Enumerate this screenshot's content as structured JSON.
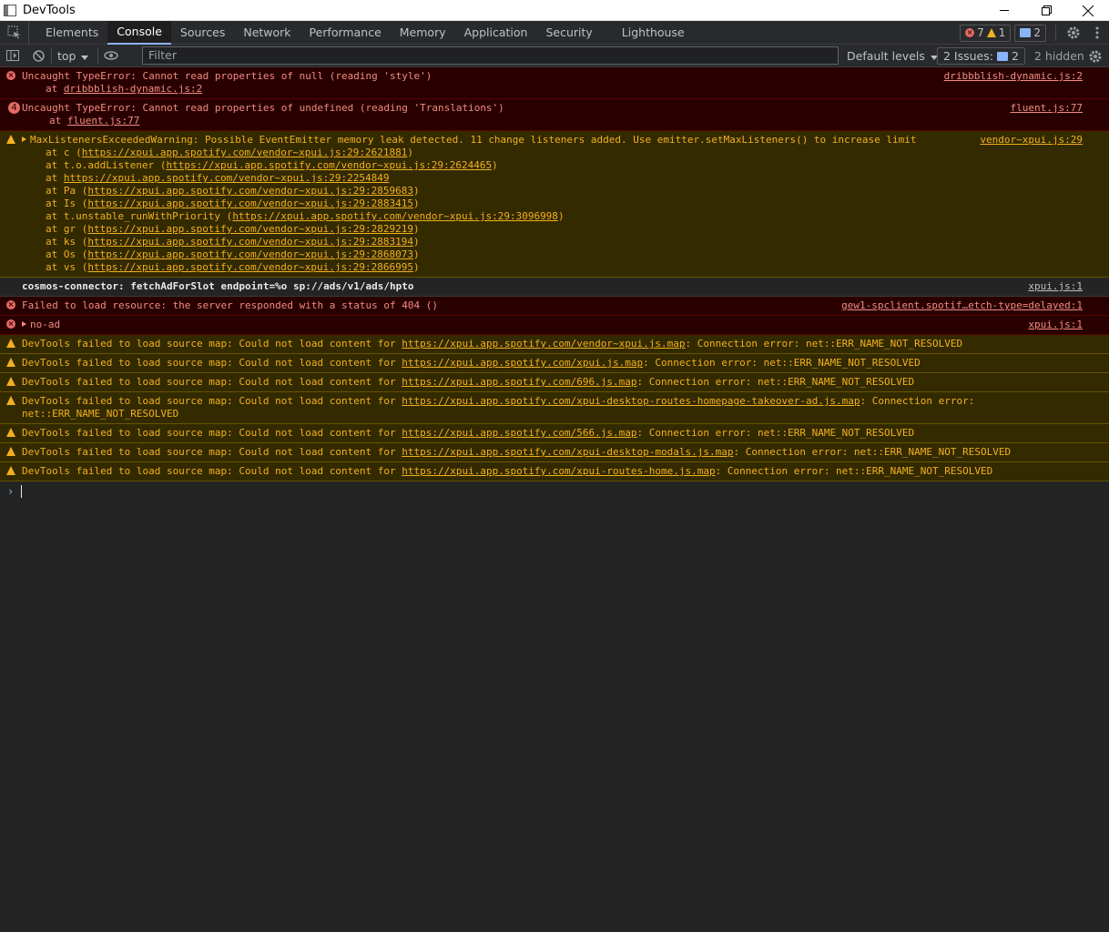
{
  "window": {
    "title": "DevTools"
  },
  "tabs": [
    "Elements",
    "Console",
    "Sources",
    "Network",
    "Performance",
    "Memory",
    "Application",
    "Security",
    "Lighthouse"
  ],
  "active_tab": "Console",
  "counts": {
    "errors": "7",
    "warnings": "1",
    "messages": "2"
  },
  "toolbar": {
    "context": "top",
    "filter_placeholder": "Filter",
    "levels": "Default levels",
    "issues_label": "2 Issues:",
    "issues_count": "2",
    "hidden": "2 hidden"
  },
  "colors": {
    "error_bg": "#290000",
    "warn_bg": "#332a00",
    "error_text": "#f28b82",
    "warn_text": "#f2b021",
    "accent": "#8ab4f8"
  },
  "messages": [
    {
      "level": "error",
      "icon": "error-icon",
      "text": "Uncaught TypeError: Cannot read properties of null (reading 'style')",
      "source": "dribbblish-dynamic.js:2",
      "stack_prefix": "at ",
      "stack_link": "dribbblish-dynamic.js:2"
    },
    {
      "level": "error",
      "icon": "error-count",
      "count": "4",
      "text": "Uncaught TypeError: Cannot read properties of undefined (reading 'Translations')",
      "source": "fluent.js:77",
      "stack_prefix": "at ",
      "stack_link": "fluent.js:77"
    },
    {
      "level": "warning",
      "text": "MaxListenersExceededWarning: Possible EventEmitter memory leak detected. 11 change listeners added. Use emitter.setMaxListeners() to increase limit",
      "source": "vendor~xpui.js:29",
      "stack": [
        {
          "fn": "at c (",
          "url": "https://xpui.app.spotify.com/vendor~xpui.js:29:2621881",
          "end": ")"
        },
        {
          "fn": "at t.o.addListener (",
          "url": "https://xpui.app.spotify.com/vendor~xpui.js:29:2624465",
          "end": ")"
        },
        {
          "fn": "at ",
          "url": "https://xpui.app.spotify.com/vendor~xpui.js:29:2254849",
          "end": ""
        },
        {
          "fn": "at Pa (",
          "url": "https://xpui.app.spotify.com/vendor~xpui.js:29:2859683",
          "end": ")"
        },
        {
          "fn": "at Is (",
          "url": "https://xpui.app.spotify.com/vendor~xpui.js:29:2883415",
          "end": ")"
        },
        {
          "fn": "at t.unstable_runWithPriority (",
          "url": "https://xpui.app.spotify.com/vendor~xpui.js:29:3096998",
          "end": ")"
        },
        {
          "fn": "at gr (",
          "url": "https://xpui.app.spotify.com/vendor~xpui.js:29:2829219",
          "end": ")"
        },
        {
          "fn": "at ks (",
          "url": "https://xpui.app.spotify.com/vendor~xpui.js:29:2883194",
          "end": ")"
        },
        {
          "fn": "at Os (",
          "url": "https://xpui.app.spotify.com/vendor~xpui.js:29:2868073",
          "end": ")"
        },
        {
          "fn": "at vs (",
          "url": "https://xpui.app.spotify.com/vendor~xpui.js:29:2866995",
          "end": ")"
        }
      ]
    },
    {
      "level": "info",
      "text": "cosmos-connector:  fetchAdForSlot endpoint=%o sp://ads/v1/ads/hpto",
      "source": "xpui.js:1"
    },
    {
      "level": "error",
      "icon": "error-icon",
      "text": "Failed to load resource: the server responded with a status of 404 ()",
      "source": "gew1-spclient.spotif…etch-type=delayed:1"
    },
    {
      "level": "error",
      "icon": "error-icon",
      "expand": true,
      "text": "no-ad",
      "source": "xpui.js:1"
    },
    {
      "level": "warning",
      "pre": "DevTools failed to load source map: Could not load content for ",
      "url": "https://xpui.app.spotify.com/vendor~xpui.js.map",
      "post": ": Connection error: net::ERR_NAME_NOT_RESOLVED"
    },
    {
      "level": "warning",
      "pre": "DevTools failed to load source map: Could not load content for ",
      "url": "https://xpui.app.spotify.com/xpui.js.map",
      "post": ": Connection error: net::ERR_NAME_NOT_RESOLVED"
    },
    {
      "level": "warning",
      "pre": "DevTools failed to load source map: Could not load content for ",
      "url": "https://xpui.app.spotify.com/696.js.map",
      "post": ": Connection error: net::ERR_NAME_NOT_RESOLVED"
    },
    {
      "level": "warning",
      "pre": "DevTools failed to load source map: Could not load content for ",
      "url": "https://xpui.app.spotify.com/xpui-desktop-routes-homepage-takeover-ad.js.map",
      "post": ": Connection error:",
      "post2": "net::ERR_NAME_NOT_RESOLVED"
    },
    {
      "level": "warning",
      "pre": "DevTools failed to load source map: Could not load content for ",
      "url": "https://xpui.app.spotify.com/566.js.map",
      "post": ": Connection error: net::ERR_NAME_NOT_RESOLVED"
    },
    {
      "level": "warning",
      "pre": "DevTools failed to load source map: Could not load content for ",
      "url": "https://xpui.app.spotify.com/xpui-desktop-modals.js.map",
      "post": ": Connection error: net::ERR_NAME_NOT_RESOLVED"
    },
    {
      "level": "warning",
      "pre": "DevTools failed to load source map: Could not load content for ",
      "url": "https://xpui.app.spotify.com/xpui-routes-home.js.map",
      "post": ": Connection error: net::ERR_NAME_NOT_RESOLVED"
    }
  ]
}
